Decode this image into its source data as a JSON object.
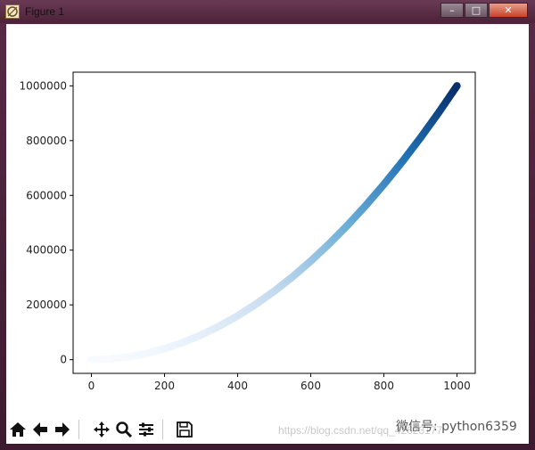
{
  "window": {
    "title": "Figure 1",
    "minimize_label": "–",
    "maximize_label": "□",
    "close_label": "✕"
  },
  "toolbar": {
    "buttons": [
      {
        "name": "home-icon"
      },
      {
        "name": "back-icon"
      },
      {
        "name": "forward-icon"
      },
      {
        "name": "pan-icon"
      },
      {
        "name": "zoom-icon"
      },
      {
        "name": "configure-subplots-icon"
      },
      {
        "name": "save-icon"
      }
    ]
  },
  "watermark_text": "https://blog.csdn.net/qq_42623177",
  "wechat_label": "微信号: python6359",
  "chart_data": {
    "type": "scatter",
    "title": "",
    "xlabel": "",
    "ylabel": "",
    "xlim": [
      -50,
      1050
    ],
    "ylim": [
      -50000,
      1050000
    ],
    "xticks": [
      0,
      200,
      400,
      600,
      800,
      1000
    ],
    "xtick_labels": [
      "0",
      "200",
      "400",
      "600",
      "800",
      "1000"
    ],
    "yticks": [
      0,
      200000,
      400000,
      600000,
      800000,
      1000000
    ],
    "ytick_labels": [
      "0",
      "200000",
      "400000",
      "600000",
      "800000",
      "1000000"
    ],
    "grid": false,
    "colormap": "Blues",
    "series": [
      {
        "x": [
          0,
          50,
          100,
          150,
          200,
          250,
          300,
          350,
          400,
          450,
          500,
          550,
          600,
          650,
          700,
          750,
          800,
          850,
          900,
          950,
          1000
        ],
        "y": [
          0,
          2500,
          10000,
          22500,
          40000,
          62500,
          90000,
          122500,
          160000,
          202500,
          250000,
          302500,
          360000,
          422500,
          490000,
          562500,
          640000,
          722500,
          810000,
          902500,
          1000000
        ]
      }
    ],
    "colors": {
      "light": "#f7fbff",
      "dark": "#08306b"
    }
  }
}
